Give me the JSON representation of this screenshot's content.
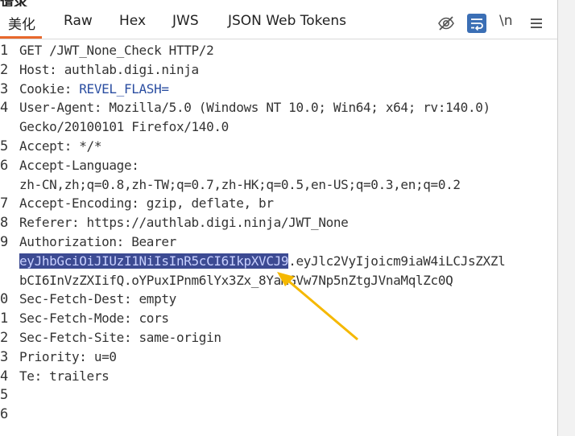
{
  "panel_title": "请求",
  "tabs": [
    {
      "label": "美化",
      "active": true
    },
    {
      "label": "Raw"
    },
    {
      "label": "Hex"
    },
    {
      "label": "JWS"
    },
    {
      "label": "JSON Web Tokens"
    }
  ],
  "toolbar": {
    "hide_icon": "eye-slash-icon",
    "wrap_icon": "word-wrap-icon",
    "newline_label": "\\n",
    "menu_icon": "hamburger-menu-icon"
  },
  "lines": [
    {
      "n": "1",
      "parts": [
        {
          "t": "GET /JWT_None_Check HTTP/2"
        }
      ]
    },
    {
      "n": "2",
      "parts": [
        {
          "t": "Host: authlab.digi.ninja"
        }
      ]
    },
    {
      "n": "3",
      "parts": [
        {
          "t": "Cookie: "
        },
        {
          "t": "REVEL_FLASH=",
          "cls": "cookie-name"
        }
      ]
    },
    {
      "n": "4",
      "parts": [
        {
          "t": "User-Agent: Mozilla/5.0 (Windows NT 10.0; Win64; x64; rv:140.0)"
        }
      ]
    },
    {
      "n": "",
      "parts": [
        {
          "t": "Gecko/20100101 Firefox/140.0"
        }
      ]
    },
    {
      "n": "5",
      "parts": [
        {
          "t": "Accept: */*"
        }
      ]
    },
    {
      "n": "6",
      "parts": [
        {
          "t": "Accept-Language:"
        }
      ]
    },
    {
      "n": "",
      "parts": [
        {
          "t": "zh-CN,zh;q=0.8,zh-TW;q=0.7,zh-HK;q=0.5,en-US;q=0.3,en;q=0.2"
        }
      ]
    },
    {
      "n": "7",
      "parts": [
        {
          "t": "Accept-Encoding: gzip, deflate, br"
        }
      ]
    },
    {
      "n": "8",
      "parts": [
        {
          "t": "Referer: https://authlab.digi.ninja/JWT_None"
        }
      ]
    },
    {
      "n": "9",
      "parts": [
        {
          "t": "Authorization: Bearer"
        }
      ]
    },
    {
      "n": "",
      "parts": [
        {
          "t": "eyJhbGciOiJIUzI1NiIsInR5cCI6IkpXVCJ9",
          "cls": "sel"
        },
        {
          "t": ".eyJlc2VyIjoicm9iaW4iLCJsZXZl"
        }
      ]
    },
    {
      "n": "",
      "parts": [
        {
          "t": "bCI6InVzZXIifQ.oYPuxIPnm6lYx3Zx_8YaMGVw7Np5nZtgJVnaMqlZc0Q"
        }
      ]
    },
    {
      "n": "0",
      "parts": [
        {
          "t": "Sec-Fetch-Dest: empty"
        }
      ]
    },
    {
      "n": "1",
      "parts": [
        {
          "t": "Sec-Fetch-Mode: cors"
        }
      ]
    },
    {
      "n": "2",
      "parts": [
        {
          "t": "Sec-Fetch-Site: same-origin"
        }
      ]
    },
    {
      "n": "3",
      "parts": [
        {
          "t": "Priority: u=0"
        }
      ]
    },
    {
      "n": "4",
      "parts": [
        {
          "t": "Te: trailers"
        }
      ]
    },
    {
      "n": "5",
      "parts": []
    },
    {
      "n": "6",
      "parts": []
    }
  ],
  "colors": {
    "accent_tab": "#e8682c",
    "selection_bg": "#3c4a92",
    "annotation_arrow": "#f5b800"
  }
}
